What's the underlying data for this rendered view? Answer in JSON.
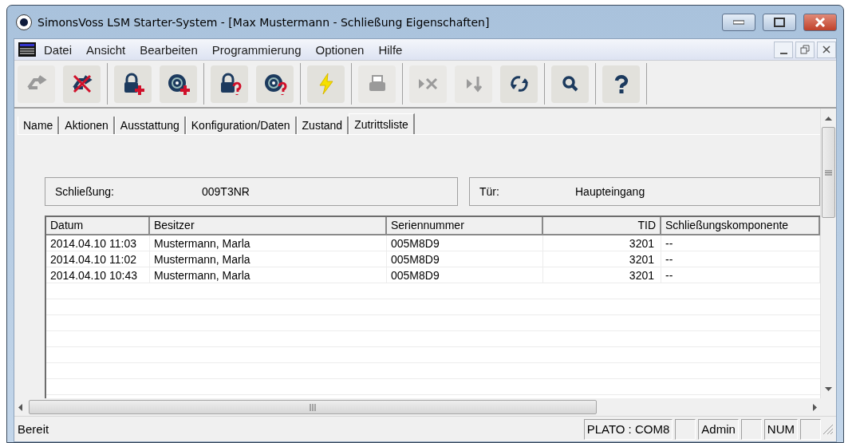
{
  "window": {
    "title": "SimonsVoss LSM Starter-System - [Max Mustermann - Schließung Eigenschaften]"
  },
  "menu": [
    "Datei",
    "Ansicht",
    "Bearbeiten",
    "Programmierung",
    "Optionen",
    "Hilfe"
  ],
  "toolbar": [
    {
      "kind": "arrows",
      "disabled": true
    },
    {
      "kind": "arrows-cross",
      "disabled": false
    },
    {
      "kind": "lock-plus",
      "disabled": false
    },
    {
      "kind": "disc-plus",
      "disabled": false
    },
    {
      "kind": "lock-question",
      "disabled": false
    },
    {
      "kind": "disc-question",
      "disabled": false
    },
    {
      "kind": "lightning",
      "disabled": false
    },
    {
      "kind": "printer",
      "disabled": true
    },
    {
      "kind": "play-x",
      "disabled": true
    },
    {
      "kind": "play-down",
      "disabled": true
    },
    {
      "kind": "refresh",
      "disabled": false
    },
    {
      "kind": "search",
      "disabled": false
    },
    {
      "kind": "help",
      "disabled": false
    }
  ],
  "tabs": [
    {
      "label": "Name",
      "selected": false
    },
    {
      "label": "Aktionen",
      "selected": false
    },
    {
      "label": "Ausstattung",
      "selected": false
    },
    {
      "label": "Konfiguration/Daten",
      "selected": false
    },
    {
      "label": "Zustand",
      "selected": false
    },
    {
      "label": "Zutrittsliste",
      "selected": true
    }
  ],
  "info": [
    {
      "label": "Schließung:",
      "value": "009T3NR"
    },
    {
      "label": "Tür:",
      "value": "Haupteingang"
    }
  ],
  "table": {
    "columns": [
      "Datum",
      "Besitzer",
      "Seriennummer",
      "TID",
      "Schließungskomponente"
    ],
    "rows": [
      [
        "2014.04.10 11:03",
        "Mustermann, Marla",
        "005M8D9",
        "3201",
        "--"
      ],
      [
        "2014.04.10 11:02",
        "Mustermann, Marla",
        "005M8D9",
        "3201",
        "--"
      ],
      [
        "2014.04.10 10:43",
        "Mustermann, Marla",
        "005M8D9",
        "3201",
        "--"
      ]
    ]
  },
  "status_bar": {
    "message": "Bereit",
    "panes": [
      "PLATO : COM8",
      "Admin",
      "NUM"
    ]
  }
}
